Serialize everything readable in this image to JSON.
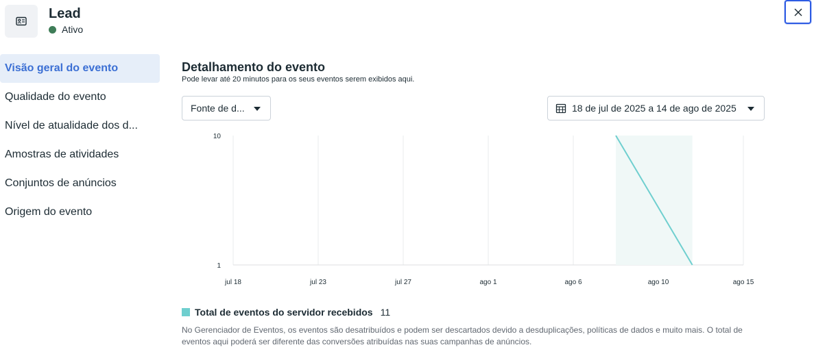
{
  "header": {
    "title": "Lead",
    "status": "Ativo",
    "icon": "id-card-icon",
    "status_color": "#3f7d58"
  },
  "close_button": {
    "icon": "close-icon"
  },
  "sidebar": {
    "items": [
      {
        "label": "Visão geral do evento",
        "active": true
      },
      {
        "label": "Qualidade do evento"
      },
      {
        "label": "Nível de atualidade dos d..."
      },
      {
        "label": "Amostras de atividades"
      },
      {
        "label": "Conjuntos de anúncios"
      },
      {
        "label": "Origem do evento"
      }
    ]
  },
  "main": {
    "title": "Detalhamento do evento",
    "subtitle": "Pode levar até 20 minutos para os seus eventos serem exibidos aqui.",
    "source_dropdown": "Fonte de d...",
    "date_dropdown": "18 de jul de 2025 a 14 de ago de 2025"
  },
  "chart_data": {
    "type": "area",
    "x_ticks": [
      "jul 18",
      "jul 23",
      "jul 27",
      "ago 1",
      "ago 6",
      "ago 10",
      "ago 15"
    ],
    "y_ticks": [
      "10",
      "1"
    ],
    "ylim": [
      1,
      10
    ],
    "y_scale": "log",
    "series": [
      {
        "name": "Total de eventos do servidor recebidos",
        "color": "#6fcfcf",
        "points": [
          {
            "x": "ago 8",
            "y": 10
          },
          {
            "x": "ago 12",
            "y": 1
          }
        ]
      }
    ],
    "grid": true
  },
  "legend": {
    "label": "Total de eventos do servidor recebidos",
    "value": "11",
    "color": "#6fcfcf"
  },
  "footnote": "No Gerenciador de Eventos, os eventos são desatribuídos e podem ser descartados devido a desduplicações, políticas de dados e muito mais. O total de eventos aqui poderá ser diferente das conversões atribuídas nas suas campanhas de anúncios."
}
